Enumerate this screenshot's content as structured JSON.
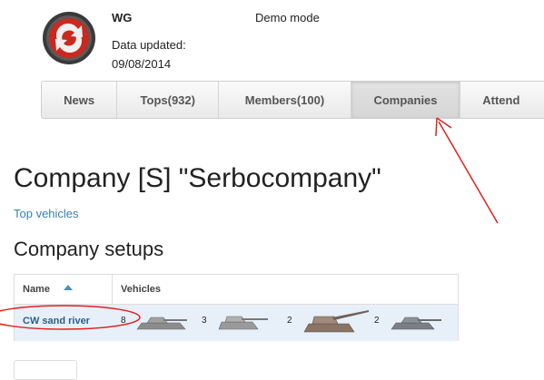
{
  "header": {
    "clan_name": "WG",
    "mode": "Demo mode",
    "updated_label": "Data updated:",
    "updated_date": "09/08/2014"
  },
  "tabs": [
    {
      "label": "News"
    },
    {
      "label": "Tops(932)"
    },
    {
      "label": "Members(100)"
    },
    {
      "label": "Companies"
    },
    {
      "label": "Attend"
    }
  ],
  "page": {
    "title": "Company [S] \"Serbocompany\"",
    "top_vehicles_link": "Top vehicles",
    "setups_heading": "Company setups"
  },
  "table": {
    "col_name": "Name",
    "col_vehicles": "Vehicles",
    "rows": [
      {
        "name": "CW sand river",
        "vehicles": [
          {
            "count": "8",
            "icon": "tank-icon"
          },
          {
            "count": "3",
            "icon": "tank-destroyer-icon"
          },
          {
            "count": "2",
            "icon": "artillery-icon"
          },
          {
            "count": "2",
            "icon": "tank-icon"
          }
        ]
      }
    ]
  },
  "colors": {
    "annotation": "#e02020",
    "link": "#3b7fb4",
    "row_highlight": "#e7f0f9"
  }
}
